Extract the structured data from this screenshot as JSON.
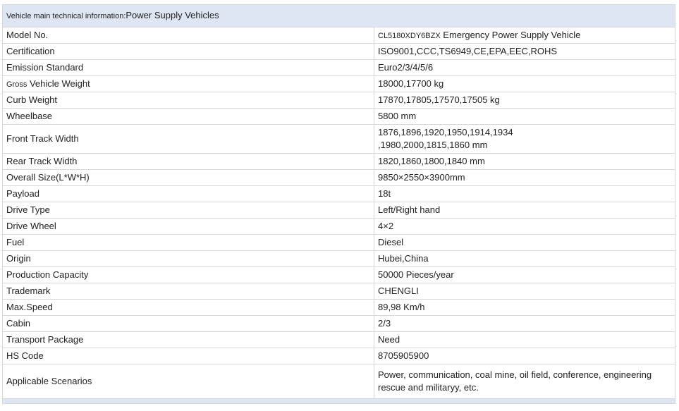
{
  "header": {
    "prefix": "Vehicle main technical information:",
    "title": "Power Supply Vehicles"
  },
  "rows": [
    {
      "label": "Model No.",
      "label_small": true,
      "value_small_part": "CL5180XDY6BZX",
      "value": " Emergency Power Supply Vehicle"
    },
    {
      "label": "Certification",
      "label_small": true,
      "value": "ISO9001,CCC,TS6949,CE,EPA,EEC,ROHS",
      "value_small": true
    },
    {
      "label": "Emission Standard",
      "value": "Euro2/3/4/5/6"
    },
    {
      "label_small_part": "Gross",
      "label": " Vehicle Weight",
      "value": "18000,17700 kg",
      "value_small": true
    },
    {
      "label": "Curb Weight",
      "label_small": true,
      "value": "17870,17805,17570,17505 kg"
    },
    {
      "label": "Wheelbase",
      "value": "5800 mm"
    },
    {
      "label": "Front Track Width",
      "value_line1": "1876,1896,1920,1950,1914,1934",
      "value_line2": ",1980,2000,1815,1860 mm"
    },
    {
      "label": "Rear Track Width",
      "value": "1820,1860,1800,1840 mm"
    },
    {
      "label": "Overall Size(L*W*H)",
      "label_small": true,
      "value": "9850×2550×3900mm",
      "value_small": true
    },
    {
      "label": "Payload",
      "value": "18t"
    },
    {
      "label": "Drive Type",
      "label_small": true,
      "value": "Left/Right hand",
      "value_small": true
    },
    {
      "label": "Drive Wheel",
      "value": "4×2"
    },
    {
      "label": "Fuel",
      "value": "Diesel"
    },
    {
      "label": "Origin",
      "value": "Hubei,China"
    },
    {
      "label": "Production Capacity",
      "value": "50000 Pieces/year"
    },
    {
      "label": "Trademark",
      "value": "CHENGLI"
    },
    {
      "label": "Max.Speed",
      "value": "89,98 Km/h"
    },
    {
      "label": "Cabin",
      "value": "2/3"
    },
    {
      "label": "Transport Package",
      "value": "Need"
    },
    {
      "label": "HS Code",
      "value": "8705905900"
    },
    {
      "label": "Applicable Scenarios",
      "value_line1": "Power, communication, coal mine, oil field, conference, engineering",
      "value_line2": "rescue and militaryy, etc."
    }
  ]
}
